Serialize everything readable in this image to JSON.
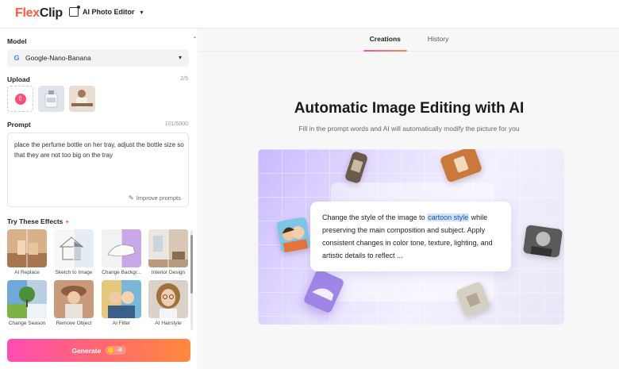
{
  "header": {
    "logo_flex": "Flex",
    "logo_clip": "Clip",
    "tool_label": "AI Photo Editor"
  },
  "left": {
    "model_label": "Model",
    "model_value": "Google-Nano-Banana",
    "upload_label": "Upload",
    "upload_count": "2/5",
    "prompt_label": "Prompt",
    "prompt_count": "101/5000",
    "prompt_text": "place the perfume bottle on her tray, adjust the bottle size so that they are not too big on the tray",
    "improve_label": "Improve prompts",
    "effects_title": "Try These Effects",
    "effects": [
      {
        "label": "AI Replace"
      },
      {
        "label": "Sketch to Image"
      },
      {
        "label": "Change Backgr..."
      },
      {
        "label": "Interior Design"
      },
      {
        "label": "Change Season"
      },
      {
        "label": "Remove Object"
      },
      {
        "label": "AI Filter"
      },
      {
        "label": "AI Hairstyle"
      }
    ],
    "generate_label": "Generate",
    "generate_cost": "-8"
  },
  "right": {
    "tabs": [
      {
        "label": "Creations",
        "active": true
      },
      {
        "label": "History",
        "active": false
      }
    ],
    "hero_title": "Automatic Image Editing with AI",
    "hero_subtitle": "Fill in the prompt words and AI will automatically modify the picture for you",
    "demo_before": "Change the style of the image to ",
    "demo_highlight": "cartoon style",
    "demo_after": " while preserving the main composition and subject. Apply consistent changes in color tone, texture, lighting, and artistic details to reflect ..."
  },
  "colors": {
    "accent_pink": "#ff4db3",
    "accent_orange": "#ff8a3d",
    "highlight": "#cfe3ff"
  }
}
